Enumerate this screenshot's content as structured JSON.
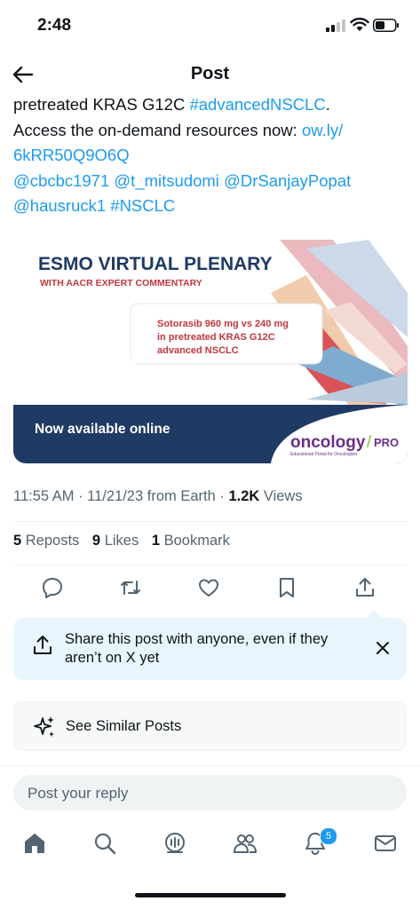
{
  "status": {
    "time": "2:48"
  },
  "header": {
    "title": "Post"
  },
  "tweet": {
    "line1_text": "pretreated KRAS G12C ",
    "line1_link": "#advancedNSCLC",
    "line1_end": ".",
    "line2_text": "Access the on-demand resources now: ",
    "line2_link": "ow.ly/",
    "line3_link": "6kRR50Q9O6Q",
    "mention1": "@cbcbc1971",
    "mention2": "@t_mitsudomi",
    "mention3": "@DrSanjayPopat",
    "mention4": "@hausruck1",
    "hashtag": "#NSCLC"
  },
  "media": {
    "title": "ESMO VIRTUAL PLENARY",
    "subtitle": "WITH AACR EXPERT COMMENTARY",
    "bubble_line1": "Sotorasib 960 mg vs 240 mg",
    "bubble_line2": "in pretreated KRAS G12C",
    "bubble_line3": "advanced NSCLC",
    "banner": "Now available online",
    "brand_oncology": "oncology",
    "brand_pro": "PRO",
    "brand_tagline": "Educational Portal for Oncologists",
    "colors": {
      "navy": "#1f3a64",
      "red": "#c2373d",
      "purple": "#6b2f86",
      "green": "#8fbf3f"
    }
  },
  "meta": {
    "time_date": "11:55 AM · 11/21/23 from Earth · ",
    "views_count": "1.2K",
    "views_label": " Views"
  },
  "stats": {
    "reposts_count": "5",
    "reposts_label": "Reposts",
    "likes_count": "9",
    "likes_label": "Likes",
    "bookmarks_count": "1",
    "bookmarks_label": "Bookmark"
  },
  "share_card": {
    "text": "Share this post with anyone, even if they aren’t on X yet"
  },
  "similar": {
    "label": "See Similar Posts"
  },
  "reply": {
    "placeholder": "Post your reply"
  },
  "tabbar": {
    "notification_badge": "5"
  },
  "colors": {
    "accent": "#1d9bf0",
    "text": "#0f1419",
    "muted": "#536471"
  }
}
